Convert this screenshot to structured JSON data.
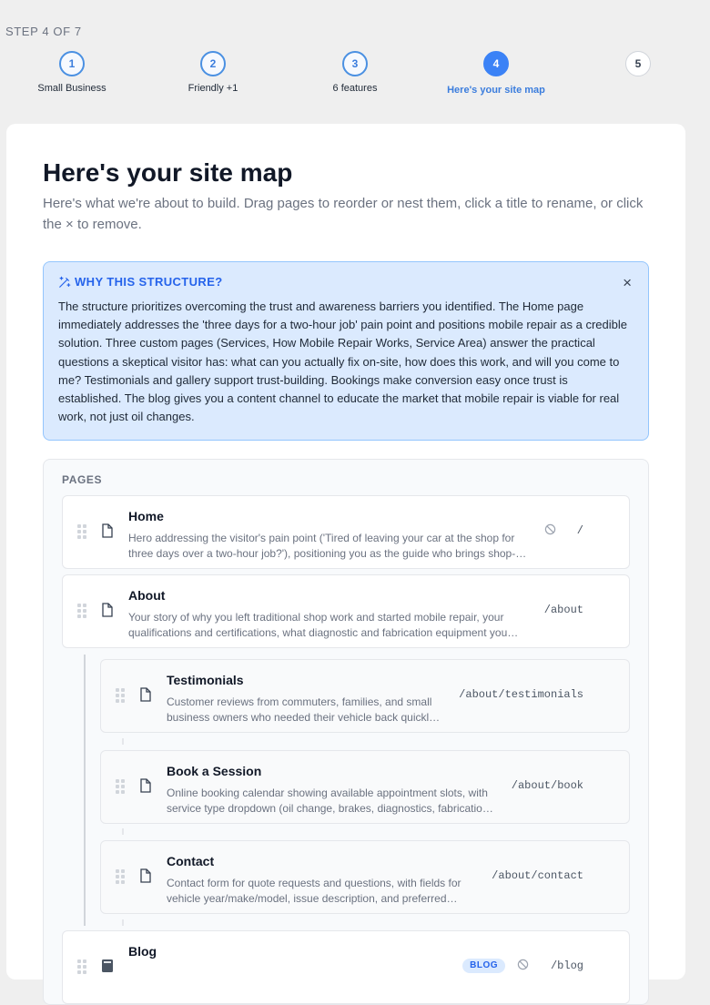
{
  "wizard": {
    "step_label": "STEP 4 OF 7",
    "steps": [
      {
        "number": "1",
        "label": "Small Business"
      },
      {
        "number": "2",
        "label": "Friendly +1"
      },
      {
        "number": "3",
        "label": "6 features"
      },
      {
        "number": "4",
        "label": "Here's your site map"
      },
      {
        "number": "5",
        "label": ""
      }
    ]
  },
  "card": {
    "title": "Here's your site map",
    "subtitle": "Here's what we're about to build. Drag pages to reorder or nest them, click a title to rename, or click the × to remove."
  },
  "why": {
    "title": "WHY THIS STRUCTURE?",
    "close": "×",
    "body": "The structure prioritizes overcoming the trust and awareness barriers you identified. The Home page immediately addresses the 'three days for a two-hour job' pain point and positions mobile repair as a credible solution. Three custom pages (Services, How Mobile Repair Works, Service Area) answer the practical questions a skeptical visitor has: what can you actually fix on-site, how does this work, and will you come to me? Testimonials and gallery support trust-building. Bookings make conversion easy once trust is established. The blog gives you a content channel to educate the market that mobile repair is viable for real work, not just oil changes."
  },
  "pages": {
    "label": "PAGES",
    "items": [
      {
        "name": "Home",
        "desc": "Hero addressing the visitor's pain point ('Tired of leaving your car at the shop for three days over a two-hour job?'), positioning you as the guide who brings shop-quality repair to their driveway.",
        "path": "/"
      },
      {
        "name": "About",
        "desc": "Your story of why you left traditional shop work and started mobile repair, your qualifications and certifications, what diagnostic and fabrication equipment you carry in the truck.",
        "path": "/about"
      },
      {
        "name": "Testimonials",
        "desc": "Customer reviews from commuters, families, and small business owners who needed their vehicle back quickly and got it fixed right where it was parked.",
        "path": "/about/testimonials"
      },
      {
        "name": "Book a Session",
        "desc": "Online booking calendar showing available appointment slots, with service type dropdown (oil change, brakes, diagnostics, fabrication) and location field.",
        "path": "/about/book"
      },
      {
        "name": "Contact",
        "desc": "Contact form for quote requests and questions, with fields for vehicle year/make/model, issue description, and preferred contact method.",
        "path": "/about/contact"
      },
      {
        "name": "Blog",
        "desc": "",
        "path": "/blog",
        "badge": "BLOG"
      }
    ]
  }
}
